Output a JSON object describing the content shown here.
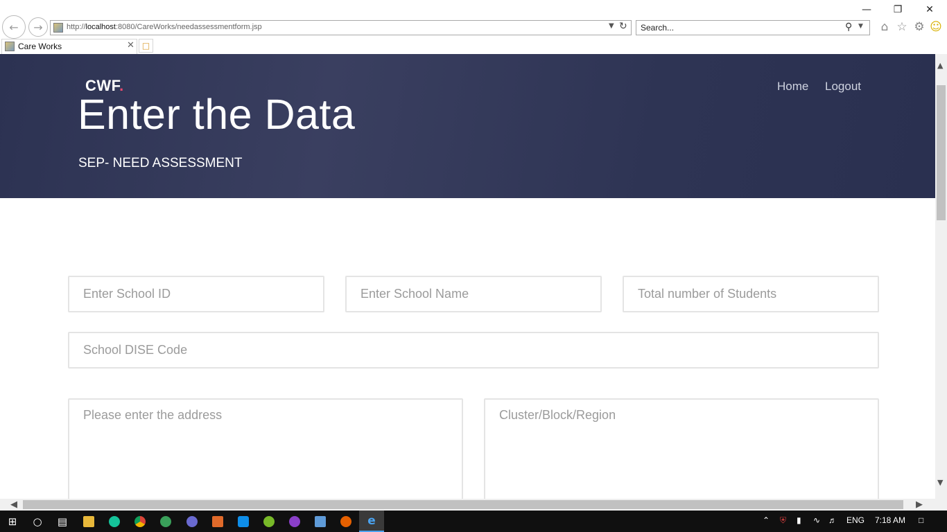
{
  "browser": {
    "url_prefix": "http://",
    "url_host": "localhost",
    "url_rest": ":8080/CareWorks/needassessmentform.jsp",
    "search_placeholder": "Search...",
    "tab_title": "Care Works"
  },
  "header": {
    "logo": "CWF",
    "logo_dot": ".",
    "title": "Enter the Data",
    "subtitle": "SEP- NEED ASSESSMENT",
    "nav": {
      "home": "Home",
      "logout": "Logout"
    }
  },
  "form": {
    "school_id_placeholder": "Enter School ID",
    "school_name_placeholder": "Enter School Name",
    "total_students_placeholder": "Total number of Students",
    "dise_code_placeholder": "School DISE Code",
    "address_placeholder": "Please enter the address",
    "cluster_placeholder": "Cluster/Block/Region"
  },
  "taskbar": {
    "language": "ENG",
    "time": "7:18 AM"
  },
  "colors": {
    "hero_background": "#2e3454",
    "logo_dot": "#e84a6f",
    "field_border": "#e4e4e4"
  }
}
